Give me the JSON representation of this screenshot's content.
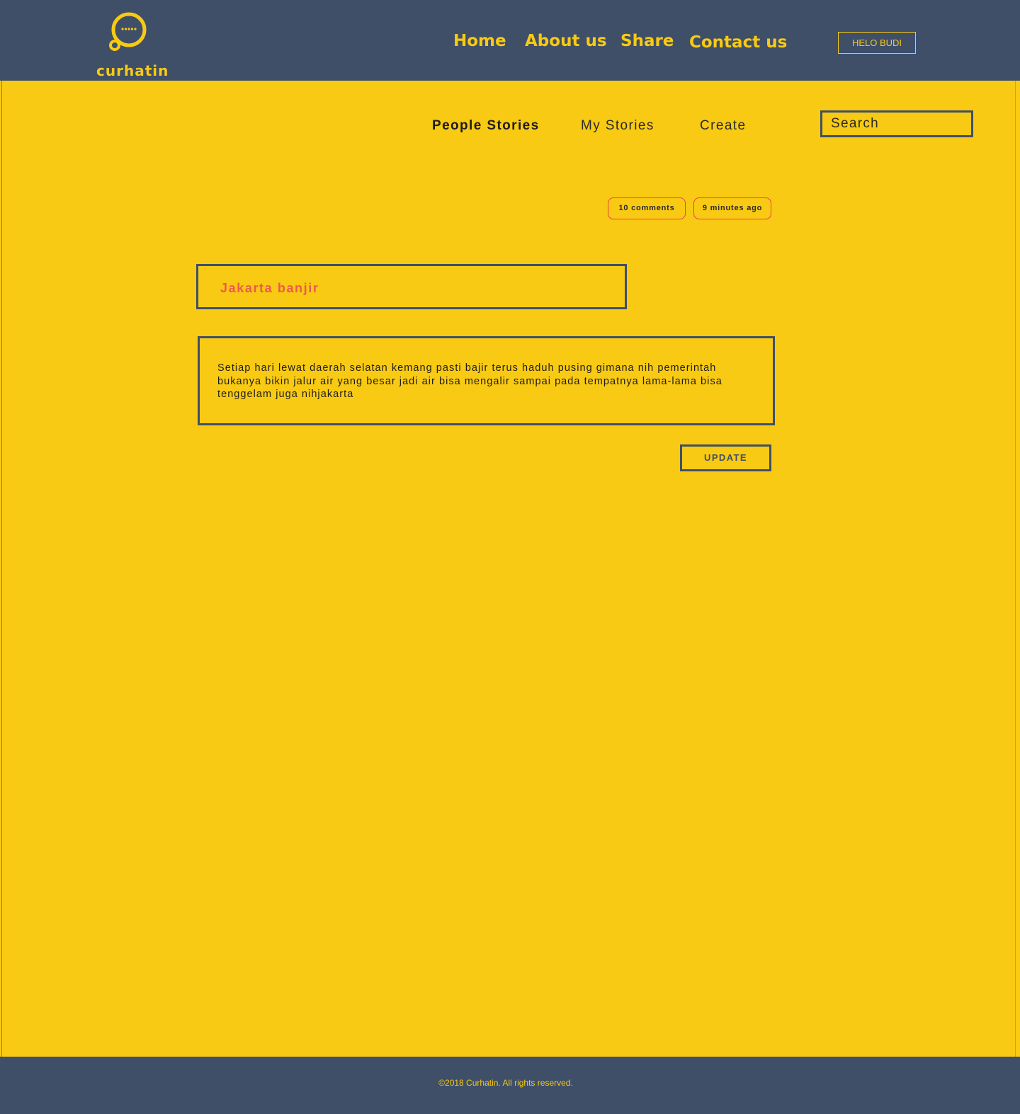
{
  "header": {
    "logo_text": "curhatin",
    "nav": {
      "home": "Home",
      "about": "About us",
      "share": "Share",
      "contact": "Contact us"
    },
    "user_button": "HELO BUDI"
  },
  "subnav": {
    "people_stories": "People Stories",
    "my_stories": "My Stories",
    "create": "Create",
    "search_placeholder": "Search"
  },
  "story": {
    "comments": "10 comments",
    "time": "9 minutes ago",
    "title": "Jakarta banjir",
    "body": "Setiap hari lewat daerah selatan kemang pasti bajir terus haduh pusing gimana nih pemerintah bukanya bikin jalur air yang besar jadi air bisa mengalir sampai pada tempatnya lama-lama bisa tenggelam juga nihjakarta",
    "update_label": "UPDATE"
  },
  "footer": {
    "copyright": "©2018 Curhatin. All rights reserved."
  },
  "colors": {
    "background": "#F9CA13",
    "header": "#3F4F68",
    "accent_text": "#F9CA13",
    "title_text": "#EC5A4A",
    "pill_border": "#E8443A"
  },
  "icons": {
    "logo": "chat-bubble-icon"
  }
}
